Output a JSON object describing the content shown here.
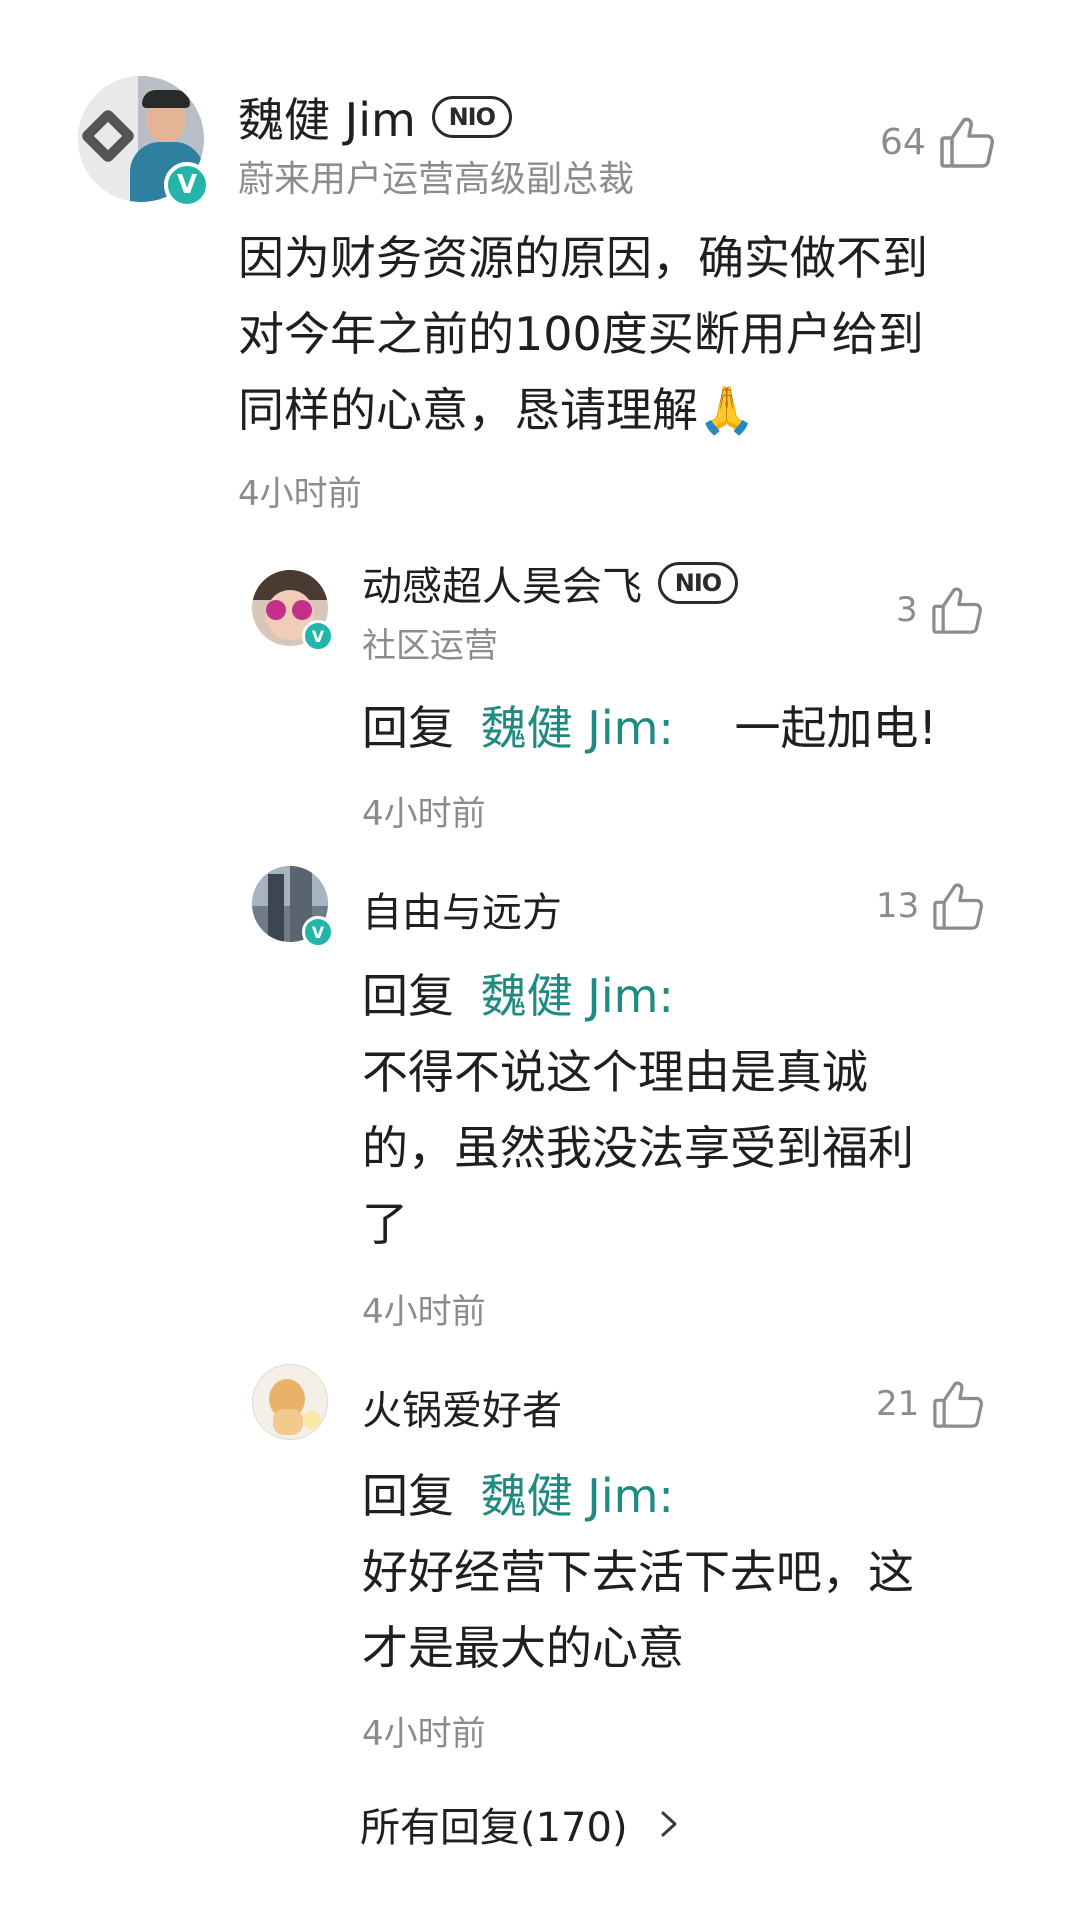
{
  "main_comment": {
    "author": "魏健 Jim",
    "badge": "NIO",
    "title": "蔚来用户运营高级副总裁",
    "likes": "64",
    "lines": [
      "因为财务资源的原因，确实做不到",
      "对今年之前的100度买断用户给到",
      "同样的心意，恳请理解🙏"
    ],
    "time": "4小时前"
  },
  "replies": [
    {
      "author": "动感超人昊会飞",
      "badge": "NIO",
      "subtitle": "社区运营",
      "likes": "3",
      "reply_prefix": "回复",
      "mention": "魏健 Jim:",
      "first_line_rest": "一起加电!",
      "lines": [],
      "time": "4小时前"
    },
    {
      "author": "自由与远方",
      "likes": "13",
      "reply_prefix": "回复",
      "mention": "魏健 Jim:",
      "lines": [
        "不得不说这个理由是真诚",
        "的，虽然我没法享受到福利",
        "了"
      ],
      "time": "4小时前"
    },
    {
      "author": "火锅爱好者",
      "likes": "21",
      "reply_prefix": "回复",
      "mention": "魏健 Jim:",
      "lines": [
        "好好经营下去活下去吧，这",
        "才是最大的心意"
      ],
      "time": "4小时前"
    }
  ],
  "all_replies_label": "所有回复(170)",
  "icons": {
    "like": "thumbs-up-icon",
    "verified": "verified-v-icon",
    "chevron": "chevron-right-icon"
  },
  "colors": {
    "accent_teal": "#22b5a8",
    "mention": "#1e8a82",
    "meta_gray": "#8c8c8c"
  }
}
